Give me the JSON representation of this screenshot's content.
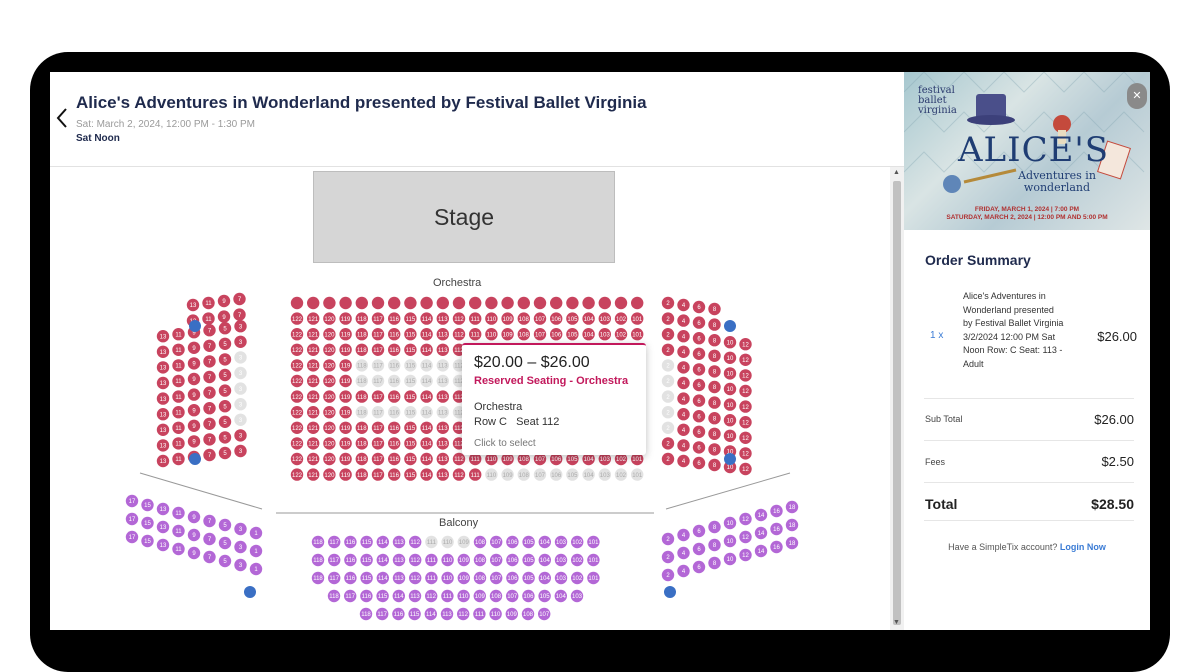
{
  "event": {
    "title": "Alice's Adventures in Wonderland presented by Festival Ballet Virginia",
    "datetime": "Sat: March 2, 2024, 12:00 PM - 1:30 PM",
    "performance": "Sat Noon"
  },
  "map": {
    "stage_label": "Stage",
    "orchestra_label": "Orchestra",
    "balcony_label": "Balcony",
    "colors": {
      "available": "#c8435e",
      "unavailable": "#e2e2e2",
      "balcony": "#b367d6",
      "accessible": "#3a6fc4"
    }
  },
  "tooltip": {
    "price": "$20.00 – $26.00",
    "section_type": "Reserved Seating - Orchestra",
    "section": "Orchestra",
    "row_seat": "Row C   Seat 112",
    "action": "Click to select"
  },
  "banner": {
    "brand": "festival ballet virginia",
    "title": "ALICE'S",
    "subtitle": "Adventures in wonderland",
    "date_line1": "FRIDAY, MARCH 1, 2024 | 7:00 PM",
    "date_line2": "SATURDAY, MARCH 2, 2024 | 12:00 PM AND 5:00 PM",
    "close_glyph": "✕"
  },
  "order": {
    "title": "Order Summary",
    "qty": "1 x",
    "item_desc": "Alice's Adventures in Wonderland presented by Festival Ballet Virginia 3/2/2024 12:00 PM Sat Noon Row: C Seat: 113 - Adult",
    "item_price": "$26.00",
    "subtotal_label": "Sub Total",
    "subtotal": "$26.00",
    "fees_label": "Fees",
    "fees": "$2.50",
    "total_label": "Total",
    "total": "$28.50",
    "account_prompt": "Have a SimpleTix account?",
    "login_label": "Login Now"
  }
}
